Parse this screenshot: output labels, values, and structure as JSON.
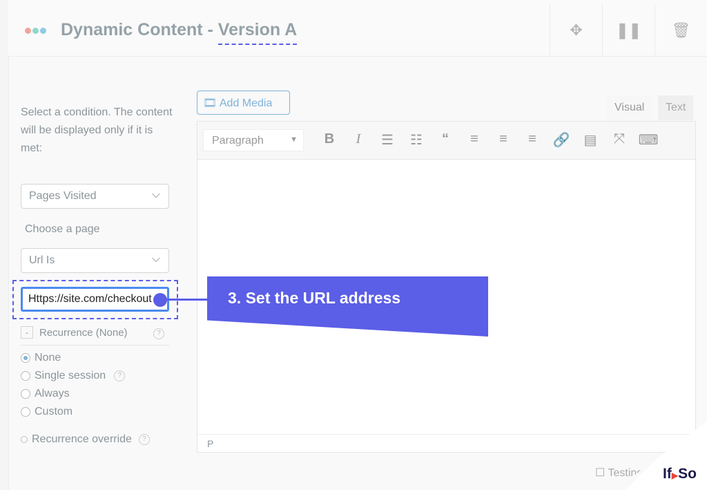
{
  "header": {
    "title": "Dynamic Content - ",
    "version": "Version A",
    "dot_colors": [
      "#f0a49a",
      "#8fd7cf",
      "#8fcbe6"
    ],
    "actions": [
      "move-icon",
      "pause-icon",
      "trash-icon"
    ]
  },
  "sidebar": {
    "instruction": "Select a condition. The content will be displayed only if it is met:",
    "condition_select": "Pages Visited",
    "choose_page_label": "Choose a page",
    "operator_select": "Url Is",
    "url_value": "Https://site.com/checkout",
    "recurrence_toggle": "-",
    "recurrence_label": "Recurrence (None)",
    "help": "?",
    "options": [
      {
        "label": "None",
        "selected": true
      },
      {
        "label": "Single session",
        "selected": false
      },
      {
        "label": "Always",
        "selected": false
      },
      {
        "label": "Custom",
        "selected": false
      }
    ],
    "override_label": "Recurrence override"
  },
  "callout": {
    "text": "3. Set the URL address",
    "color": "#5b5ee6"
  },
  "editor": {
    "add_media": "Add Media",
    "tabs": [
      "Visual",
      "Text"
    ],
    "format_select": "Paragraph",
    "status_path": "P"
  },
  "footer": {
    "testing_label": "Testing",
    "logo_left": "If",
    "logo_right": "So"
  }
}
